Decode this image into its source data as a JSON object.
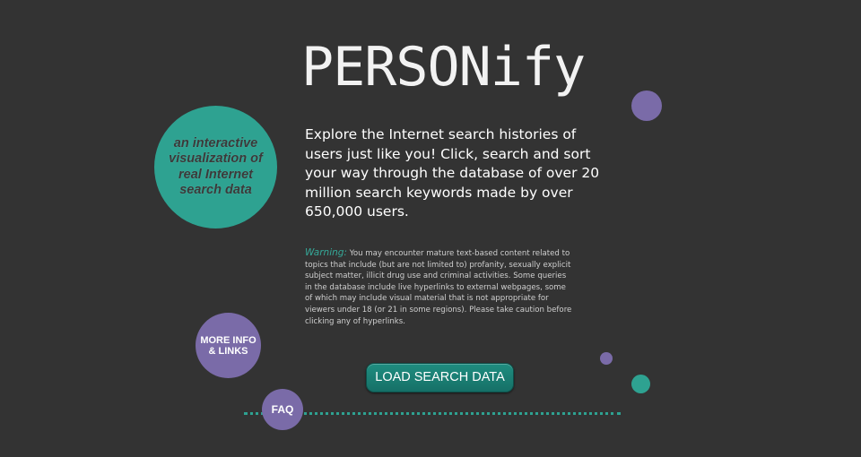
{
  "app": {
    "title": "PERSONify"
  },
  "intro": {
    "text": "Explore the Internet search histories of users just like you! Click, search and sort your way through the database of over 20 million search keywords made by over 650,000 users."
  },
  "tagline": {
    "text": "an interactive visualization of real Internet search data"
  },
  "warning": {
    "label": "Warning:",
    "text": " You may encounter mature text-based content related to topics that include (but are not limited to) profanity, sexually explicit subject matter, illicit drug use and criminal activities. Some queries in the database include live hyperlinks to external webpages, some of which may include visual material that is not appropriate for viewers under 18 (or 21 in some regions). Please take caution before clicking any of hyperlinks."
  },
  "buttons": {
    "load": "LOAD SEARCH DATA",
    "more_info": "MORE INFO & LINKS",
    "faq": "FAQ"
  },
  "colors": {
    "background": "#333333",
    "teal": "#2ea291",
    "purple": "#7a6ba8",
    "button": "#1f8d80"
  }
}
